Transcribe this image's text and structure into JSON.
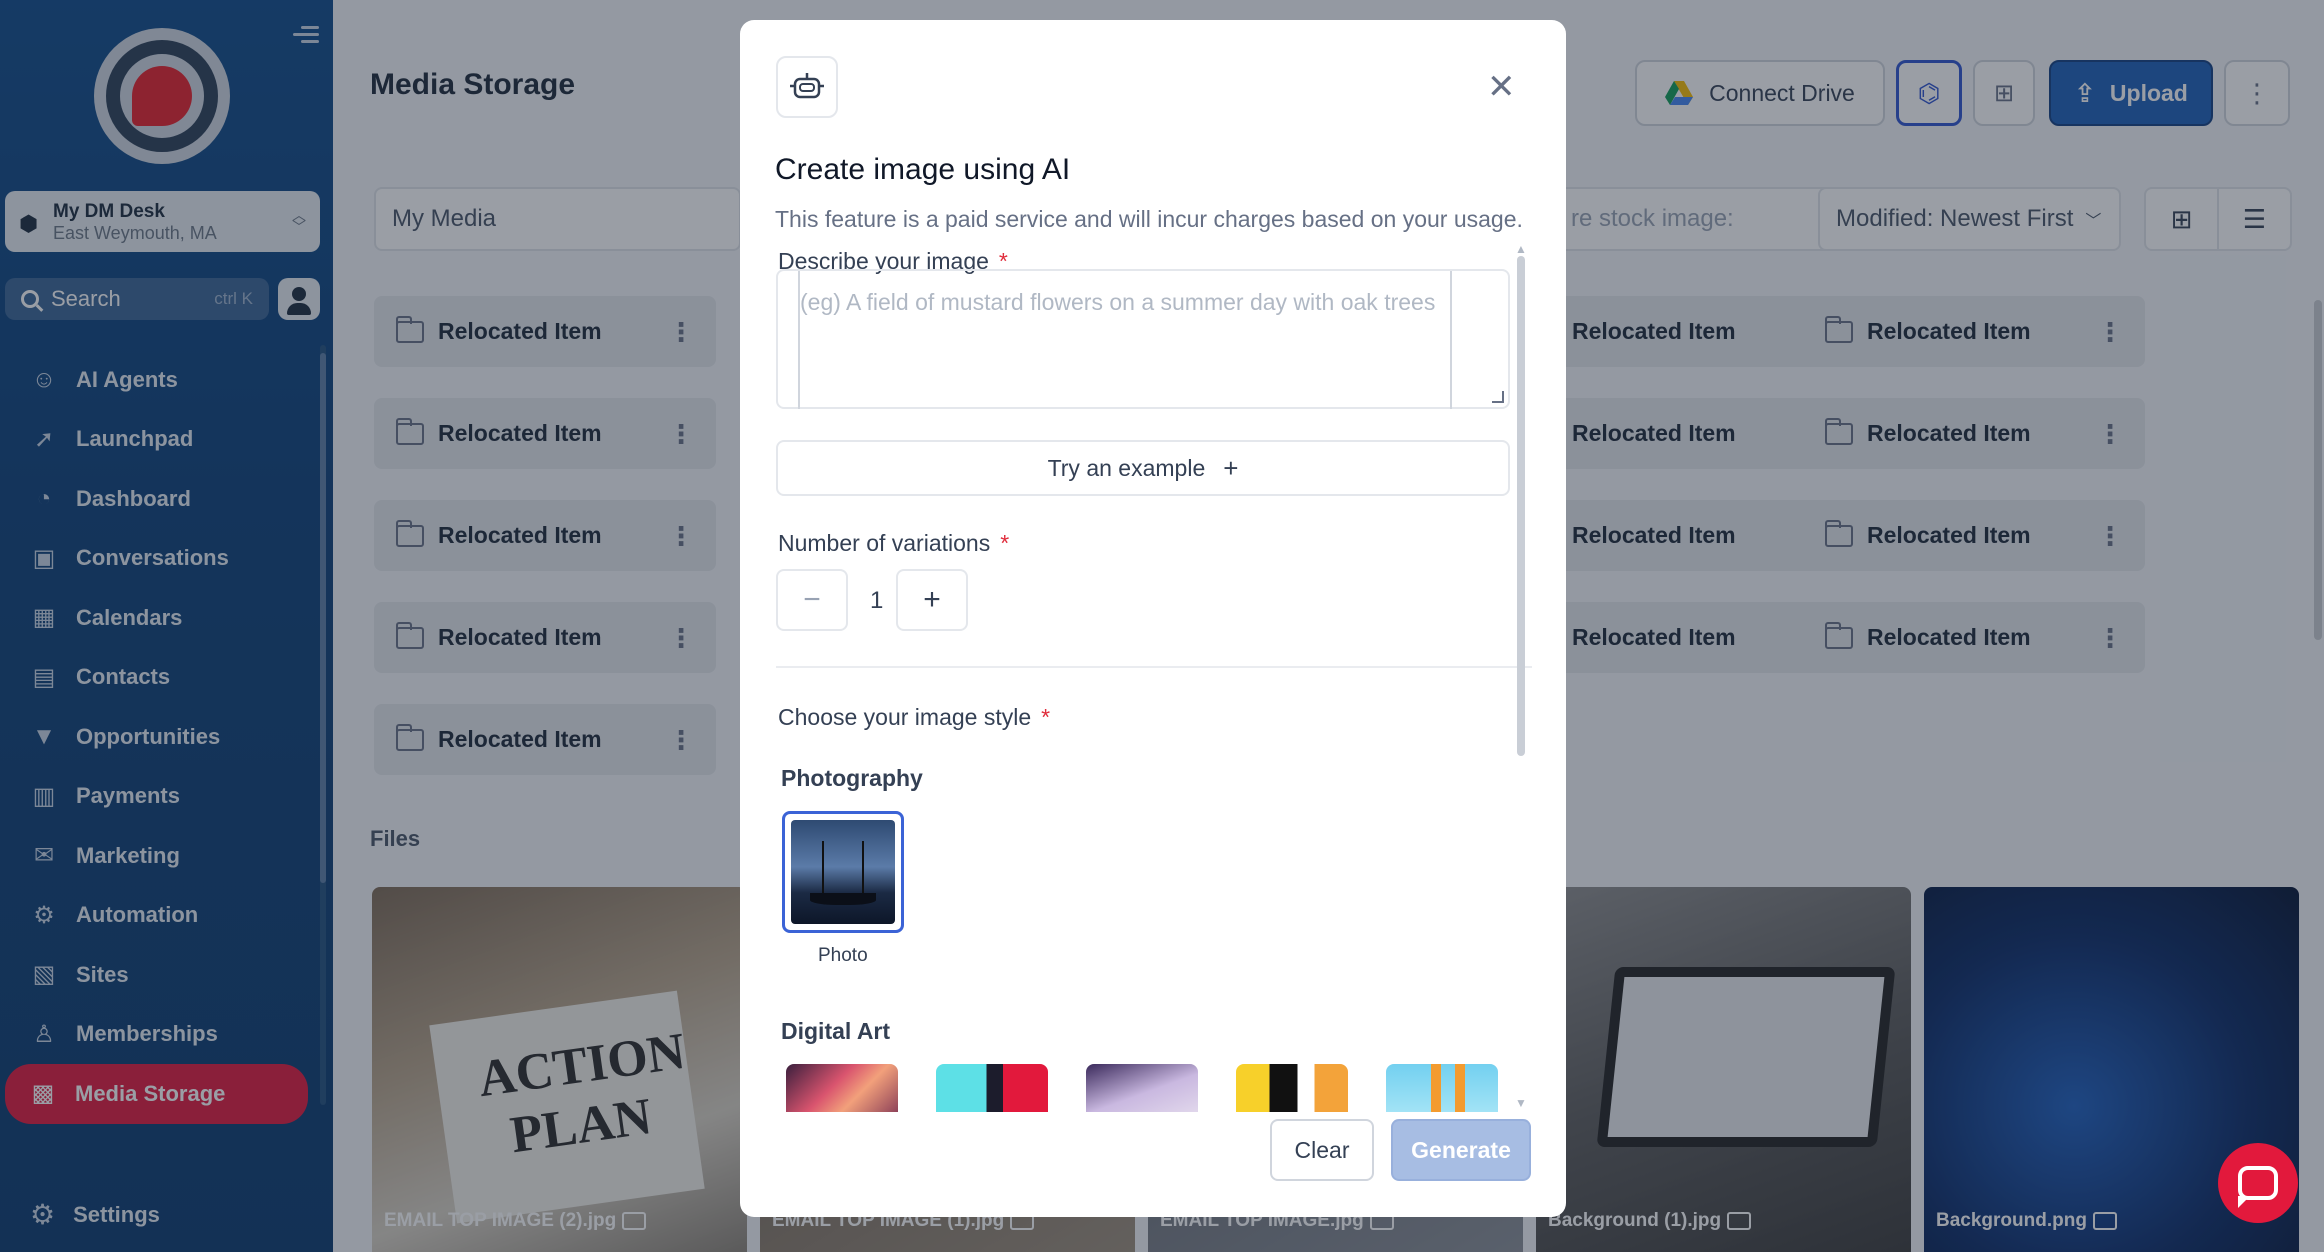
{
  "sidebar": {
    "account": {
      "name": "My DM Desk",
      "location": "East Weymouth, MA"
    },
    "search": {
      "label": "Search",
      "shortcut": "ctrl K"
    },
    "items": [
      {
        "label": "AI Agents",
        "icon": "ai-agent-icon"
      },
      {
        "label": "Launchpad",
        "icon": "rocket-icon"
      },
      {
        "label": "Dashboard",
        "icon": "gauge-icon"
      },
      {
        "label": "Conversations",
        "icon": "chat-icon"
      },
      {
        "label": "Calendars",
        "icon": "calendar-icon"
      },
      {
        "label": "Contacts",
        "icon": "contact-card-icon"
      },
      {
        "label": "Opportunities",
        "icon": "funnel-icon"
      },
      {
        "label": "Payments",
        "icon": "payments-icon"
      },
      {
        "label": "Marketing",
        "icon": "megaphone-icon"
      },
      {
        "label": "Automation",
        "icon": "automation-icon"
      },
      {
        "label": "Sites",
        "icon": "sites-icon"
      },
      {
        "label": "Memberships",
        "icon": "membership-icon"
      },
      {
        "label": "Media Storage",
        "icon": "image-icon",
        "active": true
      }
    ],
    "settings": "Settings"
  },
  "main": {
    "title": "Media Storage",
    "toolbar": {
      "connect_drive": "Connect Drive",
      "upload": "Upload"
    },
    "filter": {
      "my_media": "My Media",
      "stock_search": "re stock image:",
      "sort": "Modified: Newest First"
    },
    "folders": [
      "Relocated Item",
      "Relocated Item",
      "Relocated Item",
      "Relocated Item",
      "Relocated Item",
      "Relocated Item",
      "Relocated Item",
      "Relocated Item",
      "Relocated Item",
      "Relocated Item",
      "Relocated Item",
      "Relocated Item",
      "Relocated Item"
    ],
    "files_label": "Files",
    "files": [
      {
        "name": "EMAIL TOP IMAGE (2).jpg",
        "image_text": "ACTION PLAN"
      },
      {
        "name": "EMAIL TOP IMAGE (1).jpg"
      },
      {
        "name": "EMAIL TOP IMAGE.jpg"
      },
      {
        "name": "Background (1).jpg"
      },
      {
        "name": "Background.png"
      }
    ]
  },
  "modal": {
    "title": "Create image using AI",
    "subtitle": "This feature is a paid service and will incur charges based on your usage.",
    "describe_label": "Describe your image",
    "describe_placeholder": "(eg) A field of mustard flowers on a summer day with oak trees",
    "try_example": "Try an example",
    "variations_label": "Number of variations",
    "variations_value": "1",
    "style_label": "Choose your image style",
    "required_mark": "*",
    "categories": [
      {
        "name": "Photography",
        "styles": [
          {
            "name": "Photo",
            "selected": true
          }
        ]
      },
      {
        "name": "Digital Art",
        "styles": [
          {
            "name": ""
          },
          {
            "name": ""
          },
          {
            "name": ""
          },
          {
            "name": ""
          },
          {
            "name": ""
          }
        ]
      }
    ],
    "clear": "Clear",
    "generate": "Generate"
  },
  "colors": {
    "sidebar": "#0e4a8a",
    "active": "#e2193c",
    "primary": "#1c5fb8",
    "generate_disabled": "#a7bde3"
  }
}
